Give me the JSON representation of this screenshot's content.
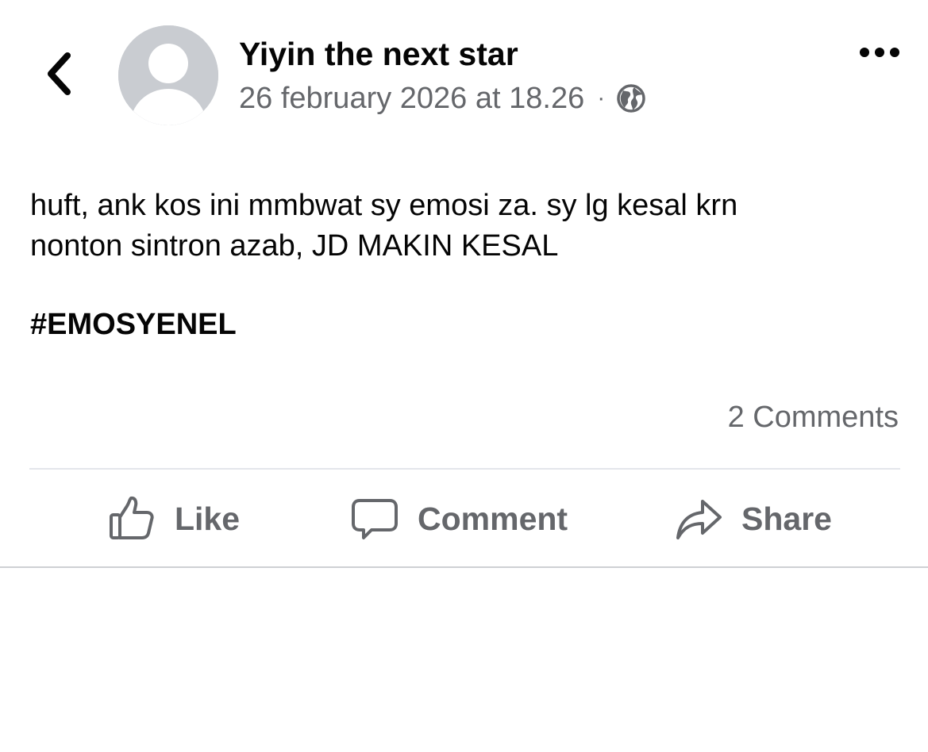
{
  "post": {
    "author": "Yiyin the next star",
    "timestamp": "26 february 2026 at 18.26",
    "separator": "·",
    "privacy_icon": "globe-icon",
    "text": "huft, ank kos ini mmbwat sy emosi za. sy lg kesal krn\nnonton sintron azab, JD MAKIN KESAL",
    "hashtag": "#EMOSYENEL",
    "comments_count": "2 Comments"
  },
  "header": {
    "back_icon": "chevron-left-icon",
    "more_icon": "more-options-icon",
    "avatar_icon": "default-avatar"
  },
  "actions": {
    "like_label": "Like",
    "like_icon": "thumbs-up-icon",
    "comment_label": "Comment",
    "comment_icon": "speech-bubble-icon",
    "share_label": "Share",
    "share_icon": "share-arrow-icon"
  },
  "colors": {
    "primary_text": "#050505",
    "secondary_text": "#65676b",
    "avatar_bg": "#c9ccd1",
    "divider": "#e4e6eb"
  }
}
